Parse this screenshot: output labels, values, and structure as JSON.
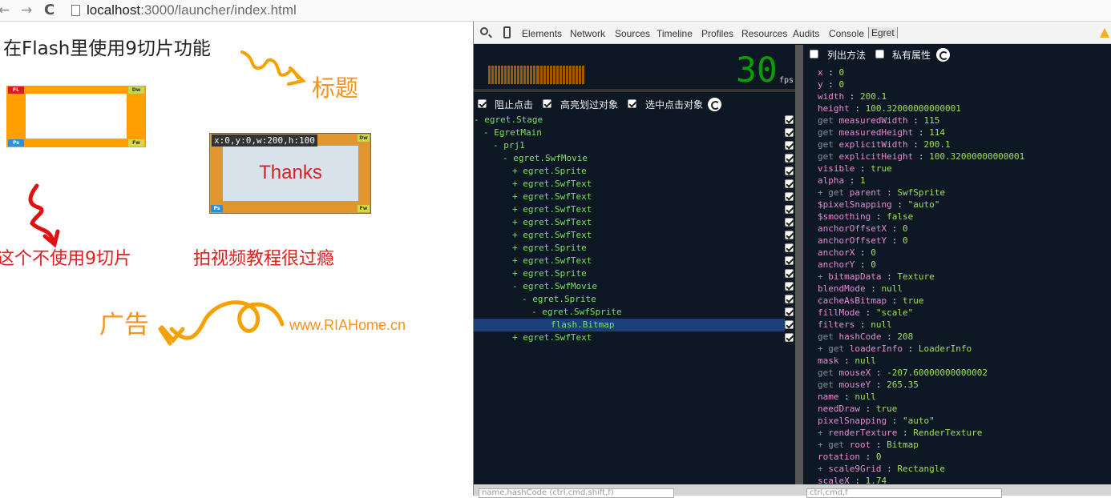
{
  "browser": {
    "back_glyph": "←",
    "forward_glyph": "→",
    "reload_glyph": "C",
    "url_host": "localhost",
    "url_path": ":3000/launcher/index.html"
  },
  "stage": {
    "title": "在Flash里使用9切片功能",
    "label_title": "标题",
    "label_no_nine": "这个不使用9切片",
    "label_video": "拍视频教程很过瘾",
    "label_ad": "广告",
    "ad_url": "www.RIAHome.cn",
    "frame_corners": [
      "FL",
      "Dw",
      "Ps",
      "Fw"
    ],
    "thanks_text": "Thanks",
    "thanks_tooltip": "x:0,y:0,w:200,h:100",
    "colors": {
      "orange": "#f7931e",
      "red": "#e02020"
    }
  },
  "devtools": {
    "tabs": [
      "Elements",
      "Network",
      "Sources",
      "Timeline",
      "Profiles",
      "Resources",
      "Audits",
      "Console",
      "Egret"
    ],
    "active_tab": "Egret",
    "fps_value": "30",
    "fps_unit": "fps",
    "options": [
      "阻止点击",
      "高亮划过对象",
      "选中点击对象"
    ],
    "prop_options": [
      "列出方法",
      "私有属性"
    ],
    "tree": [
      {
        "text": "- egret.Stage",
        "indent": 0
      },
      {
        "text": "- EgretMain",
        "indent": 1
      },
      {
        "text": "- prj1",
        "indent": 2
      },
      {
        "text": "- egret.SwfMovie",
        "indent": 3
      },
      {
        "text": "+ egret.Sprite",
        "indent": 4
      },
      {
        "text": "+ egret.SwfText",
        "indent": 4
      },
      {
        "text": "+ egret.SwfText",
        "indent": 4
      },
      {
        "text": "+ egret.SwfText",
        "indent": 4
      },
      {
        "text": "+ egret.SwfText",
        "indent": 4
      },
      {
        "text": "+ egret.SwfText",
        "indent": 4
      },
      {
        "text": "+ egret.Sprite",
        "indent": 4
      },
      {
        "text": "+ egret.SwfText",
        "indent": 4
      },
      {
        "text": "+ egret.Sprite",
        "indent": 4
      },
      {
        "text": "- egret.SwfMovie",
        "indent": 4
      },
      {
        "text": "- egret.Sprite",
        "indent": 5
      },
      {
        "text": "- egret.SwfSprite",
        "indent": 6
      },
      {
        "text": "flash.Bitmap",
        "indent": 8,
        "selected": true
      },
      {
        "text": "+ egret.SwfText",
        "indent": 4
      }
    ],
    "properties": [
      {
        "pre": "",
        "key": "x",
        "val": "0"
      },
      {
        "pre": "",
        "key": "y",
        "val": "0"
      },
      {
        "pre": "",
        "key": "width",
        "val": "200.1"
      },
      {
        "pre": "",
        "key": "height",
        "val": "100.32000000000001"
      },
      {
        "pre": "get ",
        "key": "measuredWidth",
        "val": "115"
      },
      {
        "pre": "get ",
        "key": "measuredHeight",
        "val": "114"
      },
      {
        "pre": "get ",
        "key": "explicitWidth",
        "val": "200.1"
      },
      {
        "pre": "get ",
        "key": "explicitHeight",
        "val": "100.32000000000001"
      },
      {
        "pre": "",
        "key": "visible",
        "val": "true"
      },
      {
        "pre": "",
        "key": "alpha",
        "val": "1"
      },
      {
        "pre": "+ get ",
        "key": "parent",
        "val": "SwfSprite"
      },
      {
        "pre": "",
        "key": "$pixelSnapping",
        "val": "\"auto\""
      },
      {
        "pre": "",
        "key": "$smoothing",
        "val": "false"
      },
      {
        "pre": "",
        "key": "anchorOffsetX",
        "val": "0"
      },
      {
        "pre": "",
        "key": "anchorOffsetY",
        "val": "0"
      },
      {
        "pre": "",
        "key": "anchorX",
        "val": "0"
      },
      {
        "pre": "",
        "key": "anchorY",
        "val": "0"
      },
      {
        "pre": "+ ",
        "key": "bitmapData",
        "val": "Texture"
      },
      {
        "pre": "",
        "key": "blendMode",
        "val": "null"
      },
      {
        "pre": "",
        "key": "cacheAsBitmap",
        "val": "true"
      },
      {
        "pre": "",
        "key": "fillMode",
        "val": "\"scale\""
      },
      {
        "pre": "",
        "key": "filters",
        "val": "null"
      },
      {
        "pre": "get ",
        "key": "hashCode",
        "val": "208"
      },
      {
        "pre": "+ get ",
        "key": "loaderInfo",
        "val": "LoaderInfo"
      },
      {
        "pre": "",
        "key": "mask",
        "val": "null"
      },
      {
        "pre": "get ",
        "key": "mouseX",
        "val": "-207.60000000000002"
      },
      {
        "pre": "get ",
        "key": "mouseY",
        "val": "265.35"
      },
      {
        "pre": "",
        "key": "name",
        "val": "null"
      },
      {
        "pre": "",
        "key": "needDraw",
        "val": "true"
      },
      {
        "pre": "",
        "key": "pixelSnapping",
        "val": "\"auto\""
      },
      {
        "pre": "+ ",
        "key": "renderTexture",
        "val": "RenderTexture"
      },
      {
        "pre": "+ get ",
        "key": "root",
        "val": "Bitmap"
      },
      {
        "pre": "",
        "key": "rotation",
        "val": "0"
      },
      {
        "pre": "+ ",
        "key": "scale9Grid",
        "val": "Rectangle"
      },
      {
        "pre": "",
        "key": "scaleX",
        "val": "1.74"
      }
    ],
    "filter_left_placeholder": "name,hashCode (ctrl,cmd,shift,f)",
    "filter_right_placeholder": "ctrl,cmd,f"
  }
}
